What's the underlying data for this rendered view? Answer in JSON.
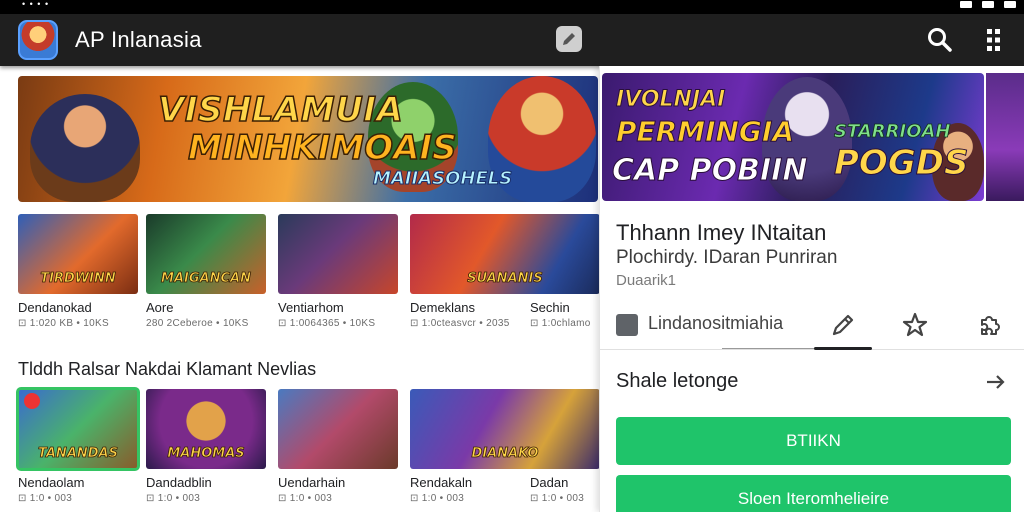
{
  "status_bar": {
    "left_text": "• • • •",
    "icons": [
      "signal-icon",
      "wifi-icon",
      "battery-icon"
    ]
  },
  "app_bar": {
    "title": "AP Inlanasia",
    "icons": [
      "app-logo-icon",
      "edit-icon",
      "search-icon",
      "more-vert-icon"
    ]
  },
  "featured_banner": {
    "line1": "VISHLAMUIA",
    "line2": "MINHKIMOAIS",
    "badge": "MAIIASOHELS"
  },
  "row1": [
    {
      "name": "Dendanokad",
      "meta": "⊡ 1:020 KB • 10KS",
      "thumb_text": "TIRDWINN"
    },
    {
      "name": "Aore",
      "meta": "280 2Ceberoe • 10KS",
      "thumb_text": "MAIGANCAN"
    },
    {
      "name": "Ventiarhom",
      "meta": "⊡ 1:0064365 • 10KS",
      "thumb_text": ""
    },
    {
      "name": "Demeklans",
      "meta": "⊡ 1:0cteasvcr • 2035",
      "thumb_text": "SUANANIS"
    },
    {
      "name": "Sechin",
      "meta": "⊡ 1:0chlamo",
      "thumb_text": ""
    }
  ],
  "section_title": "Tlddh Ralsar Nakdai Klamant Nevlias",
  "row2": [
    {
      "name": "Nendaolam",
      "meta": "⊡ 1:0 • 003",
      "thumb_text": "TANANDAS"
    },
    {
      "name": "Dandadblin",
      "meta": "⊡ 1:0 • 003",
      "thumb_text": "MAHOMAS"
    },
    {
      "name": "Uendarhain",
      "meta": "⊡ 1:0 • 003",
      "thumb_text": ""
    },
    {
      "name": "Rendakaln",
      "meta": "⊡ 1:0 • 003",
      "thumb_text": "DIANAKO"
    },
    {
      "name": "Dadan",
      "meta": "⊡ 1:0 • 003",
      "thumb_text": ""
    }
  ],
  "panel": {
    "banner": {
      "line1": "IVOLNJAI",
      "line2": "PERMINGIA",
      "line3": "CAP POBIIN",
      "line4": "STARRIOAH",
      "line5": "POGDS"
    },
    "title": "Thhann Imey INtaitan",
    "subtitle": "Plochirdy. IDaran Punriran",
    "developer": "Duaarik1",
    "tab_label": "Lindanositmiahia",
    "share_label": "Shale letonge",
    "install_label": "BTIIKN",
    "secondary_label": "Sloen Iteromhelieire"
  },
  "colors": {
    "accent_green": "#1fc46a",
    "app_bar": "#1f1f1f",
    "selected_outline": "#35c463"
  }
}
